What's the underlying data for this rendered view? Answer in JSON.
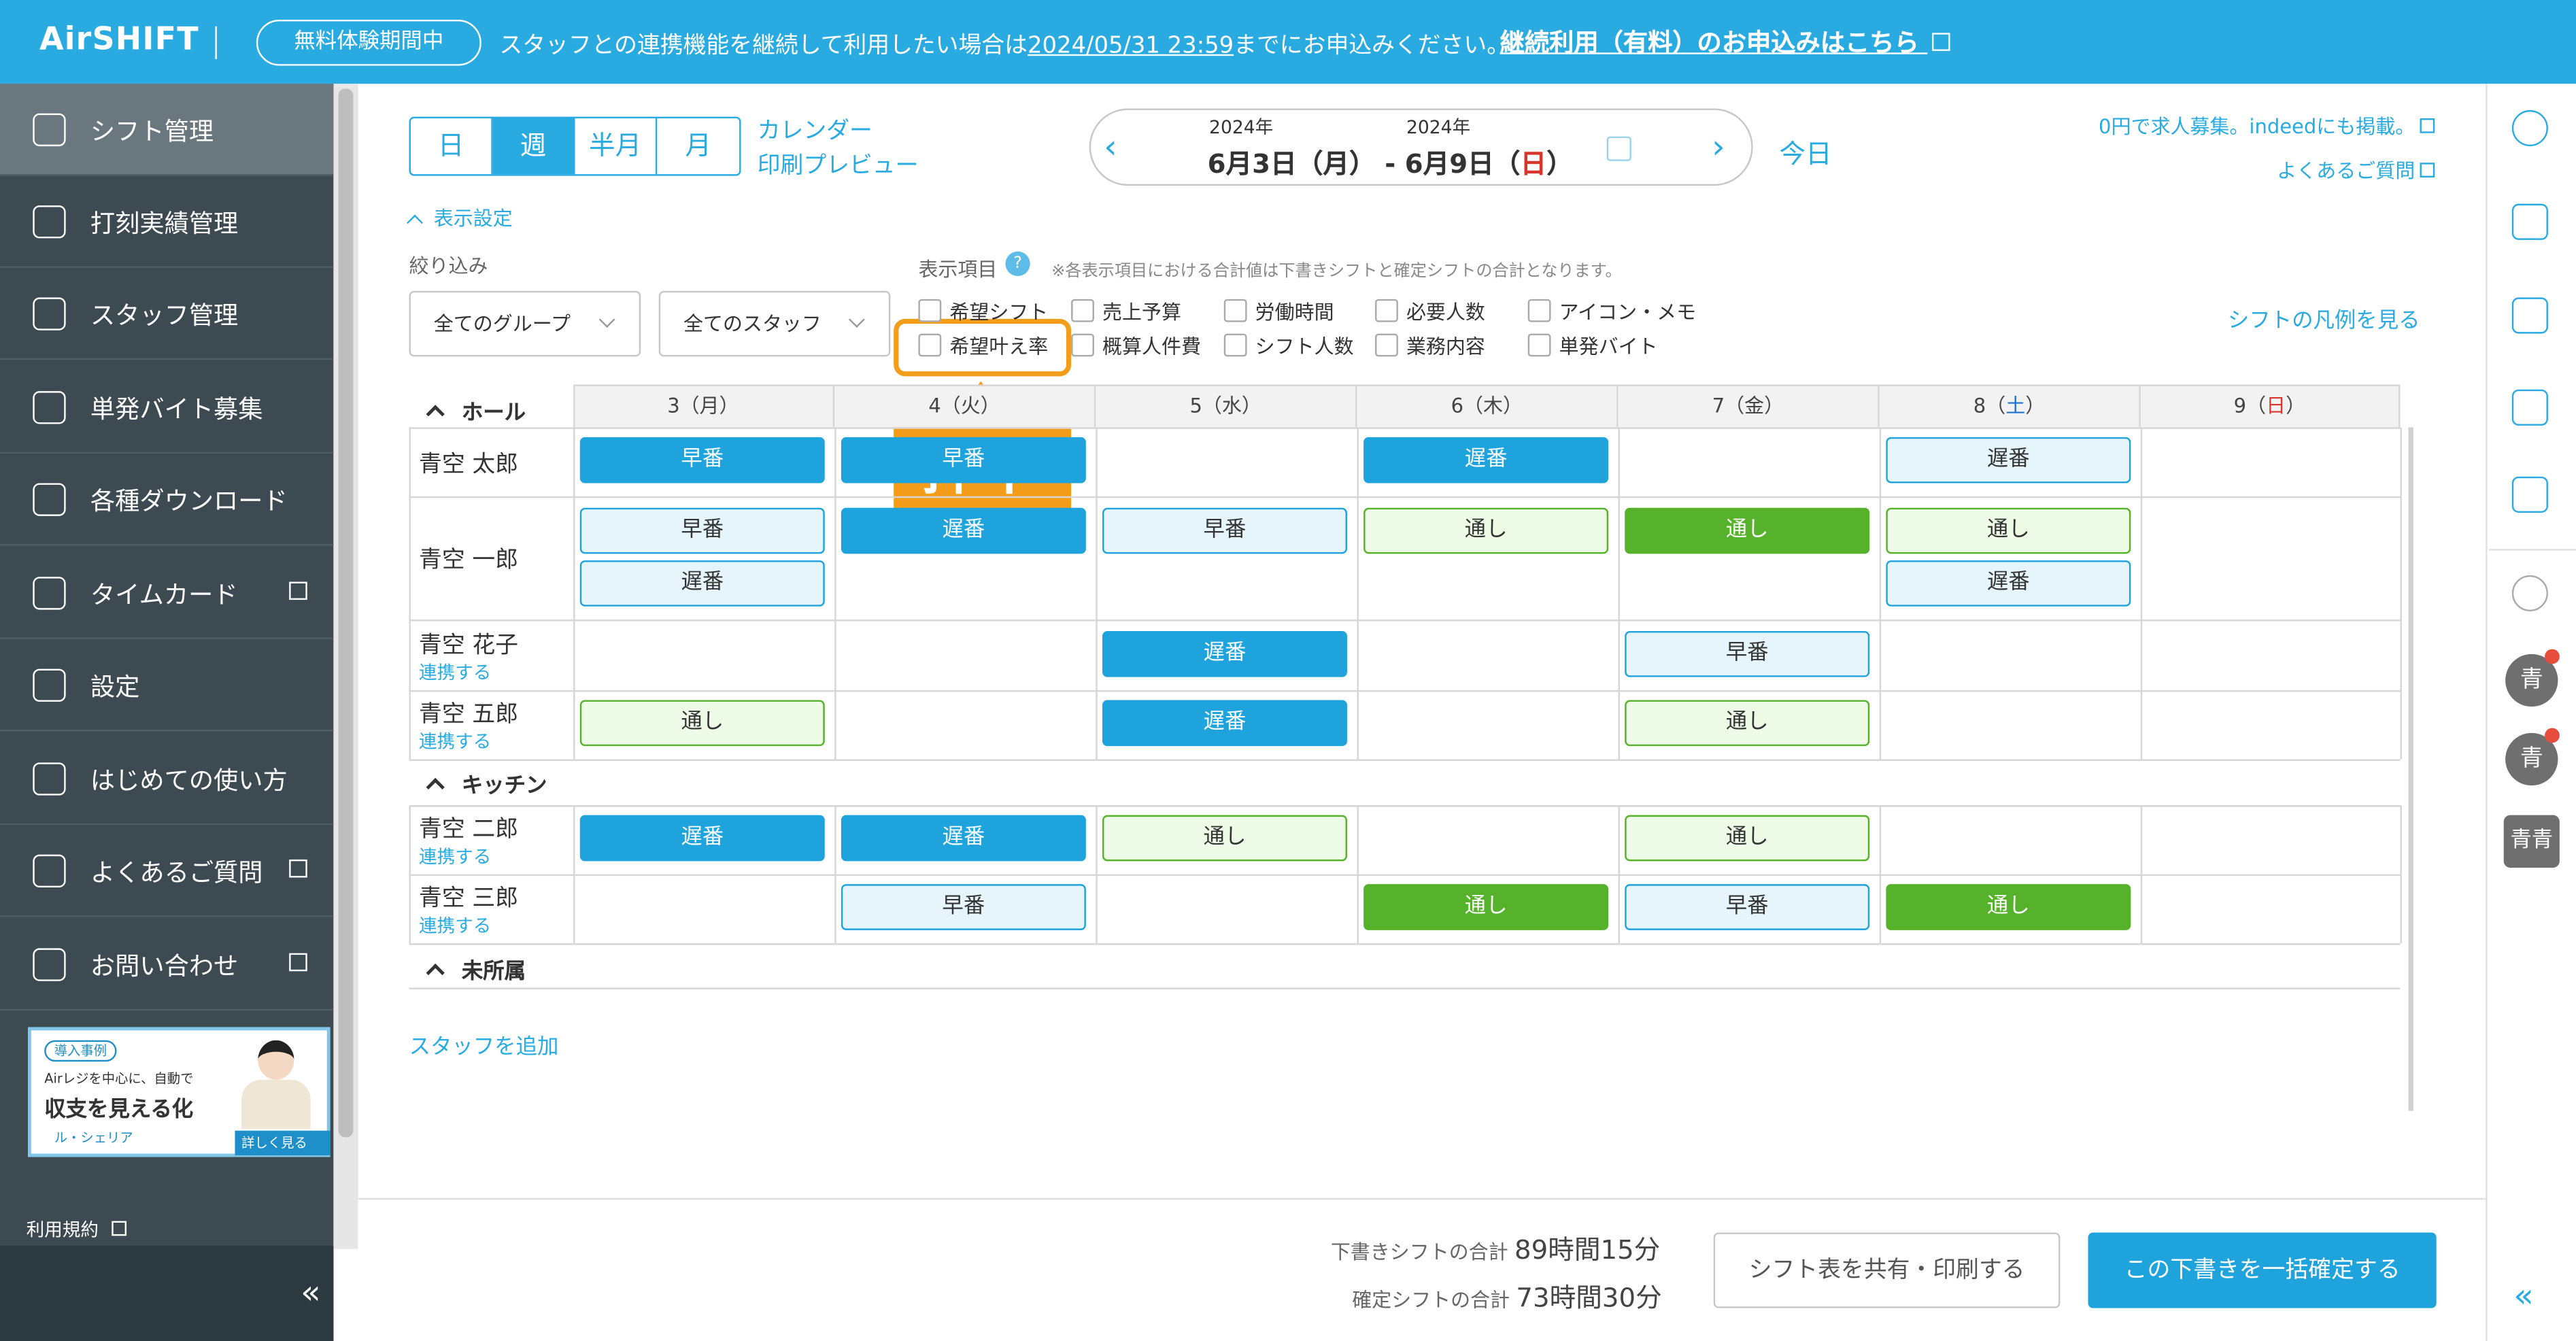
{
  "header": {
    "logo": "AirSHIFT",
    "trial_badge": "無料体験期間中",
    "banner_text_before": "スタッフとの連携機能を継続して利用したい場合は",
    "banner_deadline": "2024/05/31 23:59",
    "banner_text_after": "までにお申込みください。",
    "banner_link": "継続利用（有料）のお申込みはこちら"
  },
  "sidebar": {
    "items": [
      {
        "label": "シフト管理",
        "icon": "shift-icon",
        "active": true
      },
      {
        "label": "打刻実績管理",
        "icon": "clock-record-icon"
      },
      {
        "label": "スタッフ管理",
        "icon": "staff-card-icon"
      },
      {
        "label": "単発バイト募集",
        "icon": "search-person-icon"
      },
      {
        "label": "各種ダウンロード",
        "icon": "download-icon"
      },
      {
        "label": "タイムカード",
        "icon": "timecard-icon",
        "external": true
      },
      {
        "label": "設定",
        "icon": "gear-icon"
      },
      {
        "label": "はじめての使い方",
        "icon": "beginner-icon"
      },
      {
        "label": "よくあるご質問",
        "icon": "question-icon",
        "external": true
      },
      {
        "label": "お問い合わせ",
        "icon": "mail-icon",
        "external": true
      }
    ],
    "ad": {
      "tag": "導入事例",
      "line1": "Airレジを中心に、自動で",
      "line2": "収支を見える化",
      "brand": "ル・シェリア",
      "more": "詳しく見る"
    },
    "terms": "利用規約",
    "collapse": "«"
  },
  "toolbar": {
    "view_tabs": [
      "日",
      "週",
      "半月",
      "月"
    ],
    "active_tab": "週",
    "calendar_print_1": "カレンダー",
    "calendar_print_2": "印刷プレビュー",
    "date_year_start": "2024年",
    "date_year_end": "2024年",
    "date_start": "6月3日（月）",
    "date_sep": "-",
    "date_end_prefix": "6月9日（",
    "date_end_day": "日",
    "date_end_suffix": "）",
    "today": "今日",
    "link_recruit": "0円で求人募集。indeedにも掲載。",
    "link_faq": "よくあるご質問"
  },
  "settings": {
    "toggle": "表示設定",
    "filter_label": "絞り込み",
    "group_select": "全てのグループ",
    "staff_select": "全てのスタッフ",
    "display_label": "表示項目",
    "note": "※各表示項目における合計値は下書きシフトと確定シフトの合計となります。",
    "checkboxes_row1": [
      "希望シフト",
      "売上予算",
      "労働時間",
      "必要人数",
      "アイコン・メモ"
    ],
    "checkboxes_row2": [
      "希望叶え率",
      "概算人件費",
      "シフト人数",
      "業務内容",
      "単発バイト"
    ],
    "legend_link": "シフトの凡例を見る",
    "callout": "押下"
  },
  "table": {
    "days": [
      {
        "label": "3（月）"
      },
      {
        "label": "4（火）"
      },
      {
        "label": "5（水）"
      },
      {
        "label": "6（木）"
      },
      {
        "label": "7（金）"
      },
      {
        "prefix": "8（",
        "day": "土",
        "suffix": "）",
        "color": "#1e6fd0"
      },
      {
        "prefix": "9（",
        "day": "日",
        "suffix": "）",
        "color": "#d9362b"
      }
    ],
    "groups": [
      "ホール",
      "キッチン",
      "未所属"
    ],
    "renkei_label": "連携する",
    "staff": [
      {
        "name": "青空 太郎"
      },
      {
        "name": "青空 一郎"
      },
      {
        "name": "青空 花子"
      },
      {
        "name": "青空 五郎"
      },
      {
        "name": "青空 二郎"
      },
      {
        "name": "青空 三郎"
      }
    ],
    "shifts": {
      "早番": "早番",
      "遅番": "遅番",
      "通し": "通し"
    },
    "add_staff": "スタッフを追加"
  },
  "footer": {
    "draft_label": "下書きシフトの合計",
    "draft_value": "89時間15分",
    "confirmed_label": "確定シフトの合計",
    "confirmed_value": "73時間30分",
    "share_button": "シフト表を共有・印刷する",
    "confirm_button": "この下書きを一括確定する"
  },
  "rightrail": {
    "icons": [
      "info-icon",
      "add-user-icon",
      "doc-check-icon",
      "hourglass-doc-icon",
      "shift-check-icon",
      "chat-icon"
    ],
    "avatars": [
      "青",
      "青",
      "青青"
    ],
    "collapse": "«"
  },
  "colors": {
    "brand": "#29abe2",
    "callout": "#f49d1b",
    "sidebar": "#3d4a52",
    "early_shift": "#1ea3dd",
    "full_shift": "#55b22a"
  }
}
